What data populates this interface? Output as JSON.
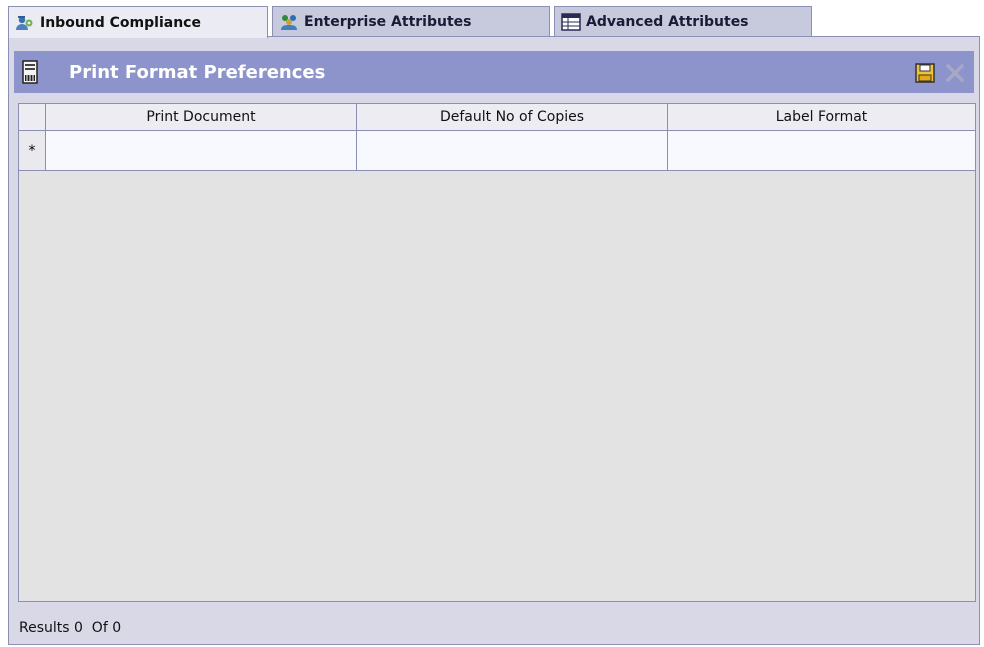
{
  "tabs": [
    {
      "label": "Inbound Compliance",
      "icon": "users-gear-icon",
      "active": true
    },
    {
      "label": "Enterprise Attributes",
      "icon": "group-icon",
      "active": false
    },
    {
      "label": "Advanced Attributes",
      "icon": "table-icon",
      "active": false
    }
  ],
  "panel": {
    "title": "Print Format Preferences",
    "icon": "printer-document-icon",
    "actions": [
      {
        "name": "save-icon"
      },
      {
        "name": "delete-icon"
      }
    ]
  },
  "table": {
    "columns": [
      "Print Document",
      "Default No of Copies",
      "Label Format"
    ],
    "new_row_marker": "*",
    "rows": []
  },
  "footer": {
    "results_text": "Results 0  Of 0"
  },
  "colors": {
    "header_bg": "#8d94cb",
    "tab_inactive_bg": "#c7c9dc",
    "panel_bg": "#d8d8e6",
    "border": "#8b8fb4"
  }
}
